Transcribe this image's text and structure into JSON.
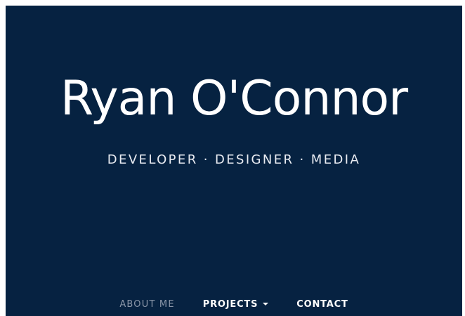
{
  "hero": {
    "name": "Ryan O'Connor",
    "tagline": "DEVELOPER · DESIGNER · MEDIA"
  },
  "nav": {
    "items": [
      {
        "label": "ABOUT ME",
        "state": "inactive"
      },
      {
        "label": "PROJECTS",
        "state": "dropdown"
      },
      {
        "label": "CONTACT",
        "state": "active"
      }
    ]
  },
  "colors": {
    "background": "#062241",
    "text": "#ffffff",
    "muted": "#8a96a8"
  }
}
